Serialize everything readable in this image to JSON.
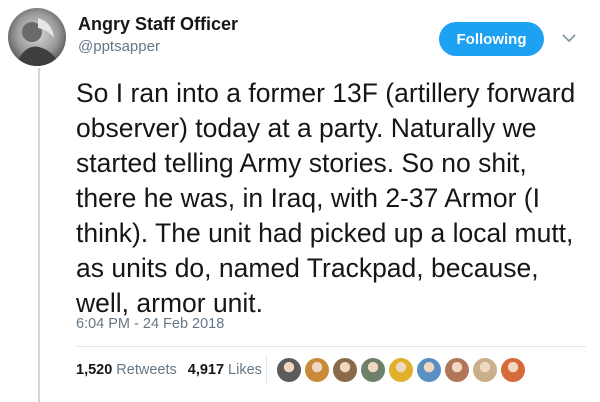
{
  "tweet": {
    "author_name": "Angry Staff Officer",
    "author_handle": "@pptsapper",
    "follow_label": "Following",
    "text": "So I ran into a former 13F (artillery forward observer) today at a party. Naturally we started telling Army stories. So no shit, there he was, in Iraq, with 2-37 Armor (I think). The unit had picked up a local mutt, as units do, named Trackpad, because, well, armor unit.",
    "timestamp": "6:04 PM - 24 Feb 2018",
    "retweets_count": "1,520",
    "retweets_label": "Retweets",
    "likes_count": "4,917",
    "likes_label": "Likes"
  },
  "icons": {
    "menu": "chevron-down-icon"
  },
  "colors": {
    "accent": "#1da1f2",
    "secondary_text": "#657786",
    "primary_text": "#14171a",
    "divider": "#e1e8ed"
  },
  "likers": [
    {
      "color": "#5b5b5b"
    },
    {
      "color": "#c98a3a"
    },
    {
      "color": "#8a6a4a"
    },
    {
      "color": "#6e7f6a"
    },
    {
      "color": "#e0b02a"
    },
    {
      "color": "#5a8fc4"
    },
    {
      "color": "#b0765a"
    },
    {
      "color": "#c9b08a"
    },
    {
      "color": "#d66a3a"
    }
  ]
}
